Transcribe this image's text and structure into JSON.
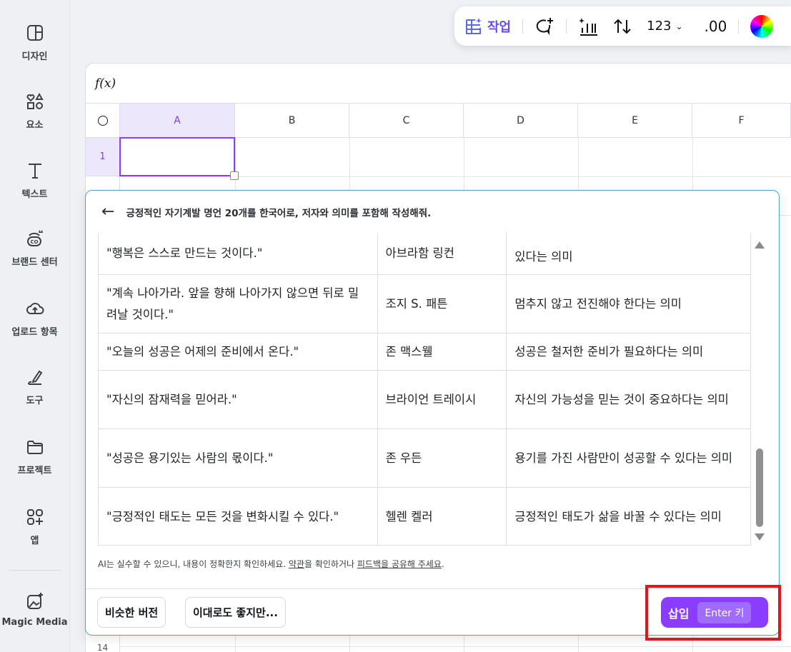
{
  "sidebar": {
    "items": [
      {
        "label": "디자인",
        "icon": "layout-icon"
      },
      {
        "label": "요소",
        "icon": "shapes-icon"
      },
      {
        "label": "텍스트",
        "icon": "text-icon"
      },
      {
        "label": "브랜드 센터",
        "icon": "brand-icon"
      },
      {
        "label": "업로드 항목",
        "icon": "cloud-upload-icon"
      },
      {
        "label": "도구",
        "icon": "pen-icon"
      },
      {
        "label": "프로젝트",
        "icon": "folder-icon"
      },
      {
        "label": "앱",
        "icon": "apps-icon"
      },
      {
        "label": "Magic Media",
        "icon": "magic-media-icon"
      }
    ]
  },
  "toolbar": {
    "task_label": "작업",
    "number_format": "123",
    "decimal": ".00"
  },
  "sheet": {
    "formula_label": "f(x)",
    "columns": [
      "A",
      "B",
      "C",
      "D",
      "E",
      "F"
    ],
    "rows": [
      "1",
      "14"
    ]
  },
  "dialog": {
    "prompt": "긍정적인 자기계발 명언 20개를 한국어로, 저자와 의미를 포함해 작성해줘.",
    "rows": [
      {
        "quote": "\"행복은 스스로 만드는 것이다.\"",
        "author": "아브라함 링컨",
        "meaning": "있다는 의미"
      },
      {
        "quote": "\"계속 나아가라. 앞을 향해 나아가지 않으면 뒤로 밀려날 것이다.\"",
        "author": "조지 S. 패튼",
        "meaning": "멈추지 않고 전진해야 한다는 의미"
      },
      {
        "quote": "\"오늘의 성공은 어제의 준비에서 온다.\"",
        "author": "존 맥스웰",
        "meaning": "성공은 철저한 준비가 필요하다는 의미"
      },
      {
        "quote": "\"자신의 잠재력을 믿어라.\"",
        "author": "브라이언 트레이시",
        "meaning": "자신의 가능성을 믿는 것이 중요하다는 의미"
      },
      {
        "quote": "\"성공은 용기있는 사람의 몫이다.\"",
        "author": "존 우든",
        "meaning": "용기를 가진 사람만이 성공할 수 있다는 의미"
      },
      {
        "quote": "\"긍정적인 태도는 모든 것을 변화시킬 수 있다.\"",
        "author": "헬렌 켈러",
        "meaning": "긍정적인 태도가 삶을 바꿀 수 있다는 의미"
      }
    ],
    "disclaimer_pre": "AI는 실수할 수 있으니, 내용이 정확한지 확인하세요. ",
    "terms_link": "약관",
    "disclaimer_mid": "을 확인하거나 ",
    "feedback_link": "피드백을 공유해 주세요",
    "disclaimer_end": ".",
    "similar_button": "비슷한 버전",
    "fine_button": "이대로도 좋지만...",
    "insert_button": "삽입",
    "insert_shortcut": "Enter 키"
  },
  "colors": {
    "accent": "#8b3dff",
    "highlight": "#e0161b"
  }
}
